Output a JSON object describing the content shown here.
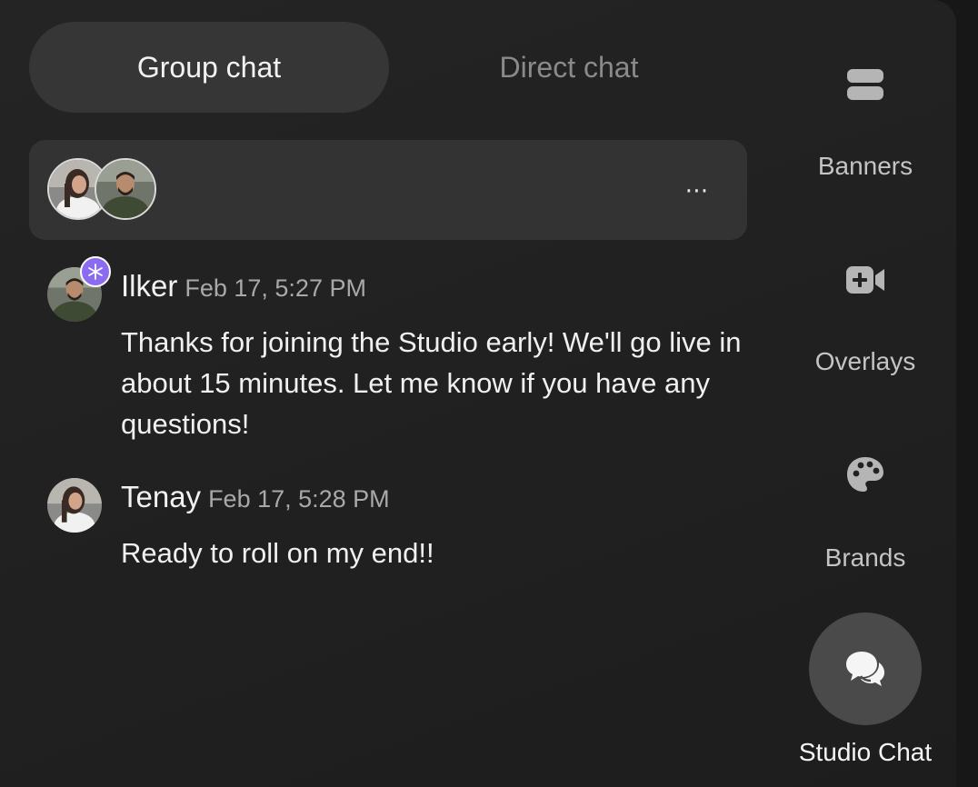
{
  "tabs": {
    "group_chat": "Group chat",
    "direct_chat": "Direct chat",
    "active": "Group chat"
  },
  "participants_bar": {
    "more_label": "⋯"
  },
  "messages": [
    {
      "author": "Ilker",
      "timestamp": "Feb 17, 5:27 PM",
      "text": "Thanks for joining the Studio early! We'll go live in about 15 minutes. Let me know if you have any questions!",
      "badge": "host-asterisk-badge"
    },
    {
      "author": "Tenay",
      "timestamp": "Feb 17, 5:28 PM",
      "text": "Ready to roll on my end!!"
    }
  ],
  "sidebar": {
    "items": [
      {
        "label": "Banners",
        "icon": "banners-icon"
      },
      {
        "label": "Overlays",
        "icon": "video-plus-icon"
      },
      {
        "label": "Brands",
        "icon": "palette-icon"
      },
      {
        "label": "Studio Chat",
        "icon": "chat-bubbles-icon",
        "active": true
      }
    ]
  },
  "colors": {
    "panel_bg": "#242424",
    "tab_active_bg": "#363636",
    "participants_bg": "#333333",
    "host_badge": "#8b6cf0",
    "active_nav_circle": "#4a4a4a"
  }
}
